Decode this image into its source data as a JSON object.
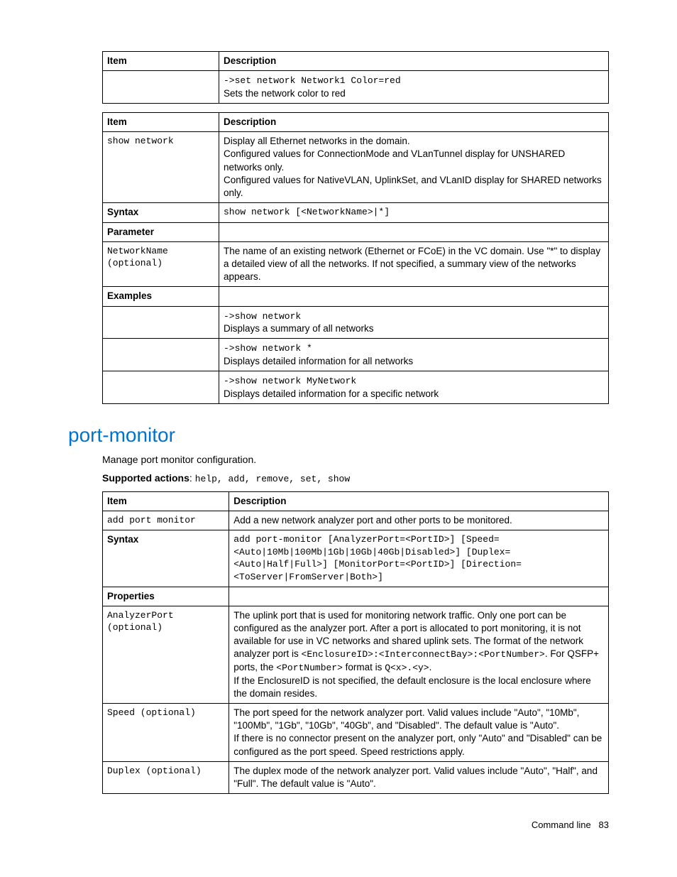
{
  "table1": {
    "header_item": "Item",
    "header_desc": "Description",
    "row": {
      "item": "",
      "code": "->set network Network1 Color=red",
      "text": "Sets the network color to red"
    }
  },
  "table2": {
    "header_item": "Item",
    "header_desc": "Description",
    "rows": {
      "show": {
        "item": "show network",
        "desc": "Display all Ethernet networks in the domain.\nConfigured values for ConnectionMode and VLanTunnel display for UNSHARED networks only.\nConfigured values for NativeVLAN, UplinkSet, and VLanID display for SHARED networks only."
      },
      "syntax": {
        "label": "Syntax",
        "code": "show network [<NetworkName>|*]"
      },
      "parameter_label": "Parameter",
      "networkname": {
        "item": "NetworkName (optional)",
        "desc": "The name of an existing network (Ethernet or FCoE) in the VC domain. Use \"*\" to display a detailed view of all the networks. If not specified, a summary view of the networks appears."
      },
      "examples_label": "Examples",
      "ex1": {
        "code": "->show network",
        "text": "Displays a summary of all networks"
      },
      "ex2": {
        "code": "->show network *",
        "text": "Displays detailed information for all networks"
      },
      "ex3": {
        "code": "->show network MyNetwork",
        "text": "Displays detailed information for a specific network"
      }
    }
  },
  "section": {
    "title": "port-monitor",
    "intro": "Manage port monitor configuration.",
    "supported_label": "Supported actions",
    "supported_actions": "help, add, remove, set, show"
  },
  "table3": {
    "header_item": "Item",
    "header_desc": "Description",
    "rows": {
      "add": {
        "item": "add port monitor",
        "desc": "Add a new network analyzer port and other ports to be monitored."
      },
      "syntax": {
        "label": "Syntax",
        "code": "add port-monitor [AnalyzerPort=<PortID>] [Speed=<Auto|10Mb|100Mb|1Gb|10Gb|40Gb|Disabled>] [Duplex=<Auto|Half|Full>] [MonitorPort=<PortID>] [Direction=<ToServer|FromServer|Both>]"
      },
      "properties_label": "Properties",
      "analyzer": {
        "item": "AnalyzerPort (optional)",
        "desc_pre": "The uplink port that is used for monitoring network traffic. Only one port can be configured as the analyzer port. After a port is allocated to port monitoring, it is not available for use in VC networks and shared uplink sets. The format of the network analyzer port is ",
        "fmt1": "<EnclosureID>:<InterconnectBay>:<PortNumber>",
        "desc_mid1": ". For QSFP+ ports, the ",
        "fmt2": "<PortNumber>",
        "desc_mid2": " format is ",
        "fmt3": "Q<x>.<y>",
        "desc_mid3": ".",
        "desc_post": "If the EnclosureID is not specified, the default enclosure is the local enclosure where the domain resides."
      },
      "speed": {
        "item": "Speed (optional)",
        "desc": "The port speed for the network analyzer port. Valid values include \"Auto\", \"10Mb\", \"100Mb\", \"1Gb\", \"10Gb\", \"40Gb\", and \"Disabled\". The default value is \"Auto\".\nIf there is no connector present on the analyzer port, only \"Auto\" and \"Disabled\" can be configured as the port speed. Speed restrictions apply."
      },
      "duplex": {
        "item": "Duplex (optional)",
        "desc": "The duplex mode of the network analyzer port. Valid values include \"Auto\", \"Half\", and \"Full\". The default value is \"Auto\"."
      }
    }
  },
  "footer": {
    "text": "Command line",
    "page": "83"
  }
}
